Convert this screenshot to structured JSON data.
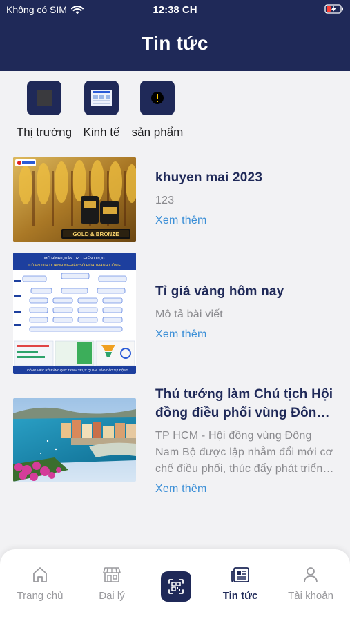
{
  "status_bar": {
    "carrier": "Không có SIM",
    "time": "12:38 CH",
    "icons": [
      "wifi-icon",
      "battery-charging-icon"
    ]
  },
  "header": {
    "title": "Tin tức",
    "background": "#1f2958"
  },
  "categories": [
    {
      "label": "Thị trường",
      "icon": "market-icon"
    },
    {
      "label": "Kinh tế",
      "icon": "economy-icon"
    },
    {
      "label": "sản phẩm",
      "icon": "product-icon"
    }
  ],
  "news": [
    {
      "title": "khuyen mai 2023",
      "description": "123",
      "more_label": "Xem thêm",
      "thumbnail_text": "GOLD & BRONZE"
    },
    {
      "title": "Tỉ giá vàng hôm nay",
      "description": "Mô tả bài viết",
      "more_label": "Xem thêm",
      "thumbnail_text": {
        "line1": "MÔ HÌNH QUẢN TRỊ CHIẾN LƯỢC",
        "line2": "CỦA 8000+ DOANH NGHIỆP SỐ HÓA THÀNH CÔNG",
        "footer": [
          "CÔNG VIỆC RÕ RÀNG",
          "QUY TRÌNH TRỰC QUAN",
          "BÁO CÁO TỰ ĐỘNG"
        ]
      }
    },
    {
      "title": "Thủ tướng làm Chủ tịch Hội đồng điều phối vùng Đông Nam Bộ",
      "description": "TP HCM - Hội đồng vùng Đông Nam Bộ được lập nhằm đổi mới cơ chế điều phối, thúc đẩy phát triển vùng",
      "more_label": "Xem thêm"
    }
  ],
  "bottom_nav": [
    {
      "label": "Trang chủ",
      "icon": "home-icon",
      "active": false
    },
    {
      "label": "Đại lý",
      "icon": "store-icon",
      "active": false
    },
    {
      "label": "",
      "icon": "qr-scan-icon",
      "active": false
    },
    {
      "label": "Tin tức",
      "icon": "news-icon",
      "active": true
    },
    {
      "label": "Tài khoản",
      "icon": "account-icon",
      "active": false
    }
  ],
  "colors": {
    "primary": "#1f2958",
    "link": "#3a8ed6",
    "muted": "#8a8a8e",
    "background": "#f2f2f4"
  }
}
